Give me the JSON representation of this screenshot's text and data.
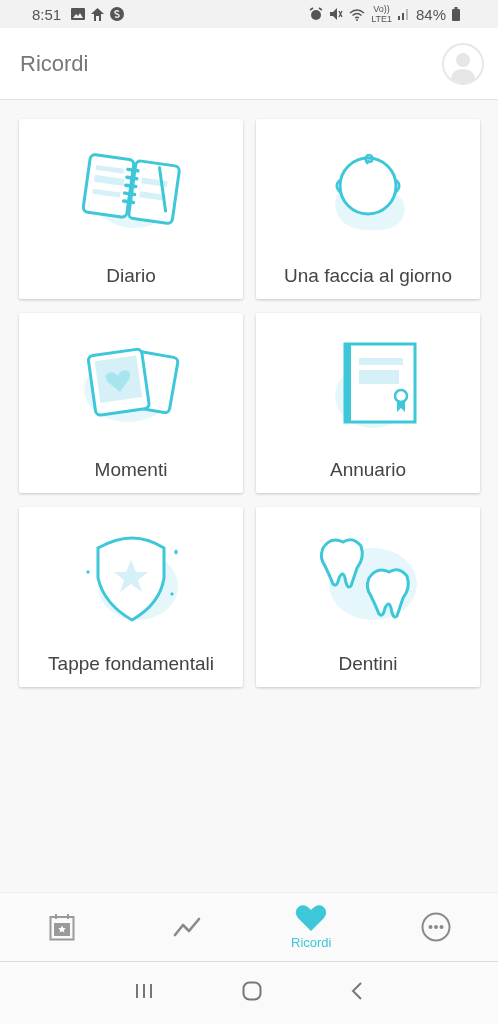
{
  "status_bar": {
    "time": "8:51",
    "volte": "Vo))",
    "network": "LTE1",
    "battery": "84%"
  },
  "header": {
    "title": "Ricordi"
  },
  "cards": [
    {
      "kind": "diary",
      "label": "Diario"
    },
    {
      "kind": "face",
      "label": "Una faccia al giorno"
    },
    {
      "kind": "moments",
      "label": "Momenti"
    },
    {
      "kind": "yearbook",
      "label": "Annuario"
    },
    {
      "kind": "milestones",
      "label": "Tappe fondamentali"
    },
    {
      "kind": "teeth",
      "label": "Dentini"
    }
  ],
  "bottom_nav": [
    {
      "kind": "calendar",
      "selected": false
    },
    {
      "kind": "chart",
      "selected": false
    },
    {
      "kind": "heart",
      "selected": true,
      "label": "Ricordi"
    },
    {
      "kind": "more",
      "selected": false
    }
  ]
}
